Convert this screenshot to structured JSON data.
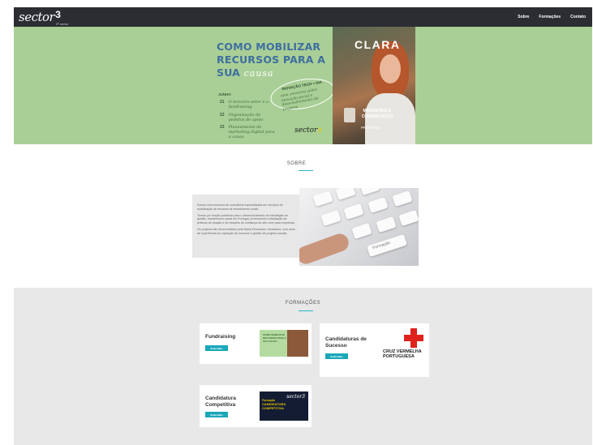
{
  "nav": {
    "logo_text": "sector",
    "logo_number": "3",
    "logo_sub": "3º sector",
    "links": [
      "Sobre",
      "Formações",
      "Contato"
    ]
  },
  "hero": {
    "title_line1": "COMO MOBILIZAR",
    "title_line2": "RECURSOS PARA A",
    "title_line3_bold": "SUA",
    "title_line3_script": "causa",
    "junho": "JUNHO",
    "dates": [
      {
        "day": "21",
        "text": "O terceiro setor e o fundraising"
      },
      {
        "day": "22",
        "text": "Organização de pedidos de apoio"
      },
      {
        "day": "23",
        "text": "Planeamento de marketing digital para a causa"
      }
    ],
    "badge_title": "INOVAÇÃO TECH + DIA",
    "badge_text": "uma conversa sobre inovação social e desenvolvimento de projetos",
    "mini_logo": "sector",
    "mini_logo_number": "3",
    "photo_name": "CLARA",
    "photo_caption": "MARKETING E COMUNICAÇÃO",
    "photo_sub": "PROJETOS"
  },
  "sobre": {
    "heading": "SOBRE",
    "paragraphs": [
      "Somos uma empresa de consultoria especializada em serviços de mobilização de recursos de investimento social.",
      "Temos por função contribuir para o desenvolvimento de estratégias de gestão, investimento social em Portugal, promovendo a facilitação de práticas de doação e de relações de confiança de alto nível para empresas.",
      "Os projetos são desenvolvidos pela Maria Fernandes, fundadora, com anos de experiência em captação de recursos e gestão de projetos sociais."
    ],
    "highlight": "Maria Fernandes",
    "key_label": "Formação"
  },
  "formacoes": {
    "heading": "FORMAÇÕES",
    "courses": [
      {
        "title": "Fundraising",
        "button": "Saiba Mais",
        "thumb_text": "COMO MOBILIZAR RECURSOS PARA A SUA CAUSA"
      },
      {
        "title": "Candidaturas de Sucesso",
        "button": "Saiba Mais",
        "partner": "CRUZ VERMELHA PORTUGUESA"
      },
      {
        "title": "Candidatura Competitiva",
        "button": "Saiba Mais",
        "thumb_small": "Formação",
        "thumb_big": "CANDIDATURA COMPETITIVA",
        "thumb_logo": "sector3"
      }
    ]
  },
  "colors": {
    "nav_bg": "#2b2d33",
    "hero_bg": "#a9cf96",
    "accent": "#1aa7b9",
    "section_bg": "#e8e8e8",
    "cross_red": "#e0221c"
  },
  "icons": [
    "logo-icon",
    "red-cross-icon"
  ]
}
